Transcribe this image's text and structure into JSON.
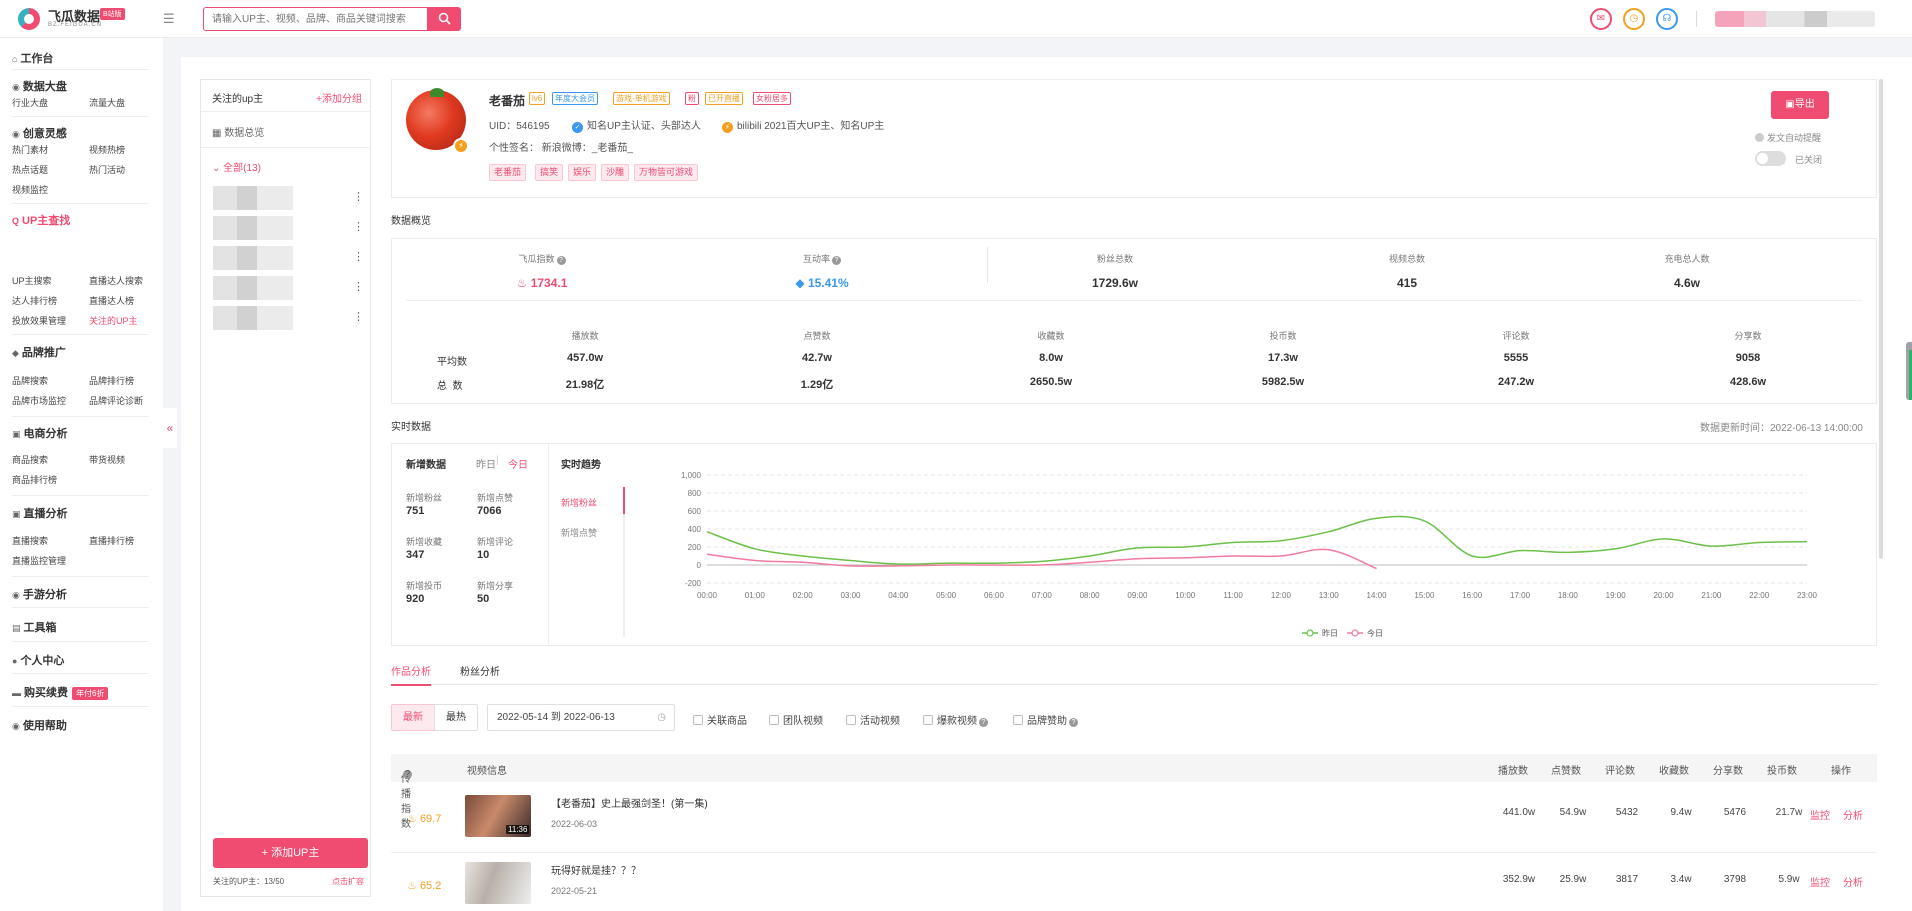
{
  "app": {
    "title": "飞瓜数据",
    "badge": "B站版",
    "domain": "BZ.FEIGUA.CN"
  },
  "search": {
    "placeholder": "请输入UP主、视频、品牌、商品关键词搜索"
  },
  "topbar": {
    "icons": [
      "mail-icon",
      "clock-icon",
      "headset-icon"
    ],
    "colors": {
      "brand": "#f04c71",
      "clock": "#f3a021",
      "service": "#3b97f0"
    }
  },
  "sidebar": {
    "workbench": "工作台",
    "data_board": {
      "title": "数据大盘",
      "items": [
        "行业大盘",
        "流量大盘"
      ]
    },
    "creative": {
      "title": "创意灵感",
      "items": [
        "热门素材",
        "视频热榜",
        "热点话题",
        "热门活动",
        "视频监控"
      ]
    },
    "up_search": {
      "title": "UP主查找",
      "items": [
        "UP主搜索",
        "直播达人搜索",
        "达人排行榜",
        "直播达人榜",
        "投放效果管理",
        "关注的UP主"
      ]
    },
    "brand": {
      "title": "品牌推广",
      "items": [
        "品牌搜索",
        "品牌排行榜",
        "品牌市场监控",
        "品牌评论诊断"
      ]
    },
    "ecommerce": {
      "title": "电商分析",
      "items": [
        "商品搜索",
        "带货视频",
        "商品排行榜"
      ]
    },
    "live": {
      "title": "直播分析",
      "items": [
        "直播搜索",
        "直播排行榜",
        "直播监控管理"
      ]
    },
    "game": "手游分析",
    "tools": "工具箱",
    "personal": "个人中心",
    "purchase": "购买续费",
    "promo": "年付6折",
    "help": "使用帮助"
  },
  "follow_panel": {
    "title": "关注的up主",
    "add_group": "+添加分组",
    "overview": "数据总览",
    "group": "全部(13)",
    "add_button": "+ 添加UP主",
    "footer": "关注的UP主：13/50",
    "expand": "点击扩容"
  },
  "profile": {
    "name": "老番茄",
    "level": "lv6",
    "tags": [
      "年度大会员",
      "游戏-单机游戏",
      "粉",
      "已开直播",
      "女粉居多"
    ],
    "uid_label": "UID：",
    "uid": "546195",
    "cert1": "知名UP主认证、头部达人",
    "cert2": "bilibili 2021百大UP主、知名UP主",
    "sign": "个性签名：  新浪微博：_老番茄_",
    "keywords": [
      "老番茄",
      "搞笑",
      "娱乐",
      "沙雕",
      "万物皆可游戏"
    ],
    "export": "导出",
    "auto_remind": "发文自动提醒",
    "toggle_label": "已关闭"
  },
  "overview": {
    "section_title": "数据概览",
    "top": [
      {
        "label": "飞瓜指数",
        "value": "1734.1"
      },
      {
        "label": "互动率",
        "value": "15.41%"
      },
      {
        "label": "粉丝总数",
        "value": "1729.6w"
      },
      {
        "label": "视频总数",
        "value": "415"
      },
      {
        "label": "充电总人数",
        "value": "4.6w"
      }
    ],
    "columns": [
      "播放数",
      "点赞数",
      "收藏数",
      "投币数",
      "评论数",
      "分享数"
    ],
    "avg_label": "平均数",
    "avg": [
      "457.0w",
      "42.7w",
      "8.0w",
      "17.3w",
      "5555",
      "9058"
    ],
    "total_label": "总  数",
    "total": [
      "21.98亿",
      "1.29亿",
      "2650.5w",
      "5982.5w",
      "247.2w",
      "428.6w"
    ]
  },
  "realtime": {
    "section_title": "实时数据",
    "updated": "数据更新时间：2022-06-13 14:00:00",
    "new_title": "新增数据",
    "yesterday": "昨日",
    "today": "今日",
    "stats": [
      {
        "label": "新增粉丝",
        "value": "751"
      },
      {
        "label": "新增点赞",
        "value": "7066"
      },
      {
        "label": "新增收藏",
        "value": "347"
      },
      {
        "label": "新增评论",
        "value": "10"
      },
      {
        "label": "新增投币",
        "value": "920"
      },
      {
        "label": "新增分享",
        "value": "50"
      }
    ],
    "trend_title": "实时趋势",
    "trend_tabs": [
      "新增粉丝",
      "新增点赞"
    ]
  },
  "chart_data": {
    "type": "line",
    "title": "",
    "x": [
      "00:00",
      "01:00",
      "02:00",
      "03:00",
      "04:00",
      "05:00",
      "06:00",
      "07:00",
      "08:00",
      "09:00",
      "10:00",
      "11:00",
      "12:00",
      "13:00",
      "14:00",
      "15:00",
      "16:00",
      "17:00",
      "18:00",
      "19:00",
      "20:00",
      "21:00",
      "22:00",
      "23:00"
    ],
    "ylim": [
      -200,
      1000
    ],
    "yticks": [
      -200,
      0,
      200,
      400,
      600,
      800,
      1000
    ],
    "ytick_labels": [
      "-200",
      "0",
      "200",
      "400",
      "600",
      "800",
      "1,000"
    ],
    "grid": true,
    "legend": "bottom",
    "series": [
      {
        "name": "昨日",
        "color": "#6cc04a",
        "values": [
          370,
          180,
          100,
          50,
          10,
          20,
          20,
          40,
          100,
          190,
          200,
          250,
          270,
          370,
          520,
          490,
          100,
          160,
          140,
          180,
          290,
          210,
          250,
          260
        ]
      },
      {
        "name": "今日",
        "color": "#f07aa0",
        "values": [
          120,
          50,
          30,
          -10,
          -10,
          0,
          0,
          0,
          30,
          70,
          80,
          100,
          100,
          170,
          -40
        ]
      }
    ]
  },
  "works": {
    "tabs": [
      "作品分析",
      "粉丝分析"
    ],
    "sort": [
      "最新",
      "最热"
    ],
    "date_range": "2022-05-14 到 2022-06-13",
    "filters": [
      "关联商品",
      "团队视频",
      "活动视频",
      "爆款视频",
      "品牌赞助"
    ],
    "headers": {
      "index": "传播指数",
      "info": "视频信息",
      "cols": [
        "播放数",
        "点赞数",
        "评论数",
        "收藏数",
        "分享数",
        "投币数"
      ],
      "op": "操作"
    },
    "rows": [
      {
        "index": "69.7",
        "title": "【老番茄】史上最强剑圣！(第一集)",
        "date": "2022-06-03",
        "duration": "11:36",
        "vals": [
          "441.0w",
          "54.9w",
          "5432",
          "9.4w",
          "5476",
          "21.7w"
        ]
      },
      {
        "index": "65.2",
        "title": "玩得好就是挂？？？",
        "date": "2022-05-21",
        "duration": "",
        "vals": [
          "352.9w",
          "25.9w",
          "3817",
          "3.4w",
          "3798",
          "5.9w"
        ]
      }
    ],
    "ops": [
      "监控",
      "分析"
    ]
  }
}
